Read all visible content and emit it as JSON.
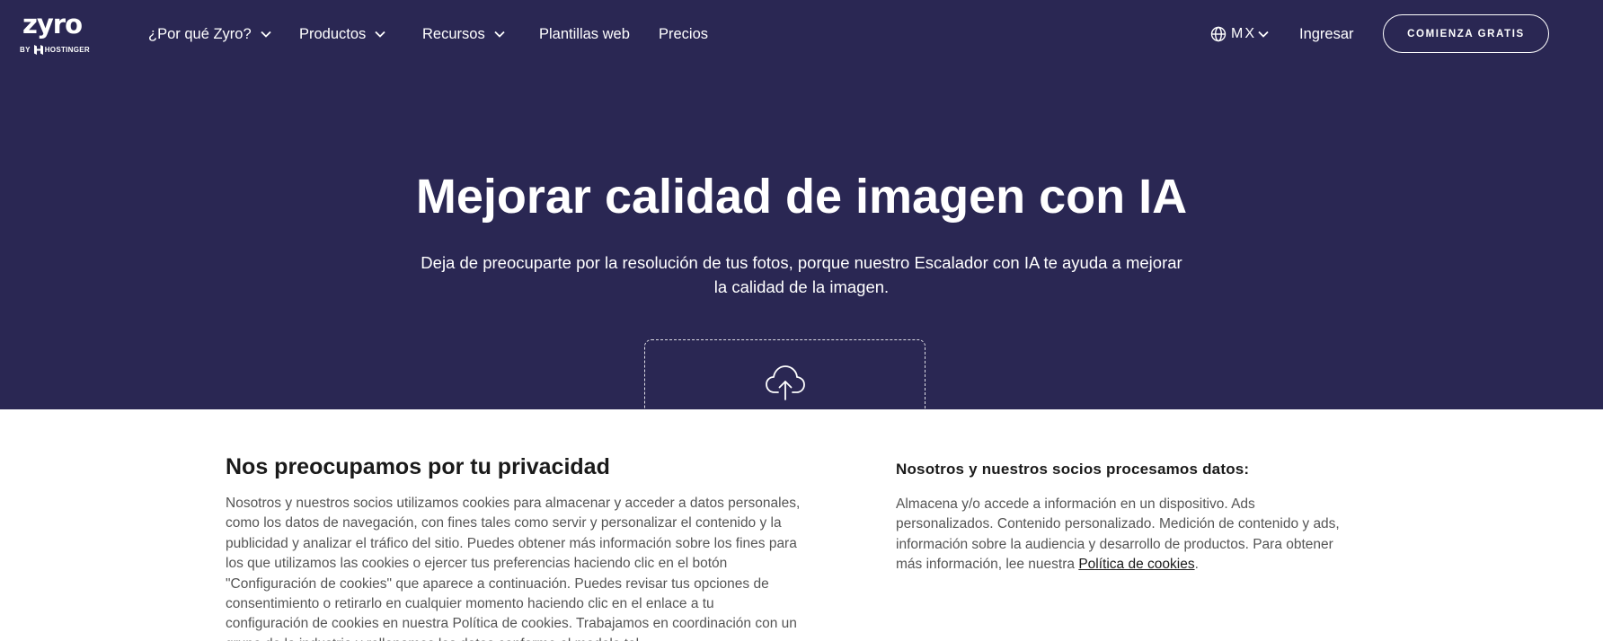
{
  "brand": {
    "logo_word": "zyro",
    "logo_by": "BY",
    "logo_parent": "HOSTINGER"
  },
  "nav": {
    "items": [
      {
        "label": "¿Por qué Zyro?",
        "has_dropdown": true
      },
      {
        "label": "Productos",
        "has_dropdown": true
      },
      {
        "label": "Recursos",
        "has_dropdown": true
      },
      {
        "label": "Plantillas web",
        "has_dropdown": false
      },
      {
        "label": "Precios",
        "has_dropdown": false
      }
    ],
    "language": "MX",
    "login": "Ingresar",
    "cta": "COMIENZA GRATIS"
  },
  "hero": {
    "title": "Mejorar calidad de imagen con IA",
    "subtitle": "Deja de preocuparte por la resolución de tus fotos, porque nuestro Escalador con IA te ayuda a mejorar la calidad de la imagen."
  },
  "cookie": {
    "title": "Nos preocupamos por tu privacidad",
    "body": "Nosotros y nuestros socios utilizamos cookies para almacenar y acceder a datos personales, como los datos de navegación, con fines tales como servir y personalizar el contenido y la publicidad y analizar el tráfico del sitio. Puedes obtener más información sobre los fines para los que utilizamos las cookies o ejercer tus preferencias haciendo clic en el botón \"Configuración de cookies\" que aparece a continuación. Puedes revisar tus opciones de consentimiento o retirarlo en cualquier momento haciendo clic en el enlace a tu configuración de cookies en nuestra Política de cookies. Trabajamos en coordinación con un grupo de la industria y rellenamos los datos conforme al modelo tal",
    "partners_title": "Nosotros y nuestros socios procesamos datos:",
    "partners_body": "Almacena y/o accede a información en un dispositivo. Ads personalizados. Contenido personalizado. Medición de contenido y ads, información sobre la audiencia y desarrollo de productos. Para obtener más información, lee nuestra ",
    "policy_link": "Política de cookies",
    "policy_end": "."
  },
  "colors": {
    "hero_bg": "#2a2753",
    "text_light": "#ffffff",
    "text_dark": "#1a1a1a",
    "text_muted": "#555555"
  },
  "icons": {
    "upload": "cloud-upload-icon",
    "language": "globe-icon",
    "dropdown": "chevron-down-icon"
  }
}
